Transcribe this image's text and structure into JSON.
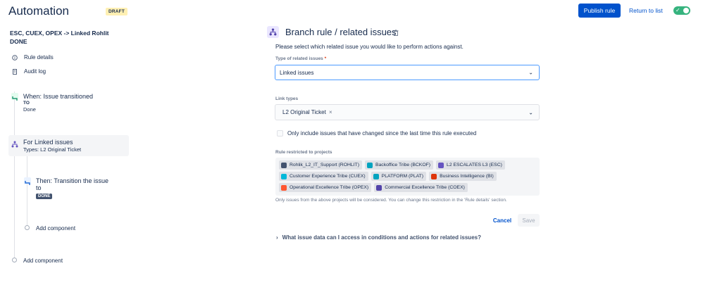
{
  "header": {
    "title": "Automation",
    "badge": "DRAFT",
    "publish_label": "Publish rule",
    "return_label": "Return to list",
    "toggle_on": true
  },
  "sidebar": {
    "rule_name": "ESC, CUEX, OPEX -> Linked Rohlit DONE",
    "nav": [
      {
        "label": "Rule details",
        "icon": "info-icon"
      },
      {
        "label": "Audit log",
        "icon": "document-icon"
      }
    ],
    "trigger": {
      "title": "When: Issue transitioned",
      "to_label": "TO",
      "to_value": "Done"
    },
    "branch": {
      "title": "For Linked issues",
      "subtitle": "Types: L2 Original Ticket"
    },
    "action": {
      "title": "Then: Transition the issue",
      "title2": "to",
      "status": "DONE"
    },
    "add_component_inner": "Add component",
    "add_component_outer": "Add component"
  },
  "panel": {
    "title": "Branch rule / related issues",
    "description": "Please select which related issue you would like to perform actions against.",
    "type_label": "Type of related issues",
    "type_required": "*",
    "type_value": "Linked issues",
    "link_types_label": "Link types",
    "link_type_value": "L2 Original Ticket",
    "link_type_remove": "×",
    "checkbox_label": "Only include issues that have changed since the last time this rule executed",
    "projects_label": "Rule restricted to projects",
    "projects": [
      {
        "name": "Rohlik_L2_IT_Support (ROHLIT)",
        "color": "#42526e"
      },
      {
        "name": "Backoffice Tribe (BCKOF)",
        "color": "#00a3bf"
      },
      {
        "name": "L2 ESCALATES L3 (ESC)",
        "color": "#6554c0"
      },
      {
        "name": "Customer Experience Tribe (CUEX)",
        "color": "#00b8d9"
      },
      {
        "name": "PLATFORM (PLAT)",
        "color": "#00a3bf"
      },
      {
        "name": "Business Intelligence (BI)",
        "color": "#de350b"
      },
      {
        "name": "Operational Excellence Tribe (OPEX)",
        "color": "#ff5630"
      },
      {
        "name": "Commercial Excellence Tribe (COEX)",
        "color": "#5243aa"
      }
    ],
    "projects_note": "Only issues from the above projects will be considered. You can change this restriction in the 'Rule details' section.",
    "cancel_label": "Cancel",
    "save_label": "Save",
    "expander_label": "What issue data can I access in conditions and actions for related issues?"
  },
  "colors": {
    "primary": "#0052cc",
    "toggle": "#36b37e",
    "focus": "#4c9aff"
  }
}
